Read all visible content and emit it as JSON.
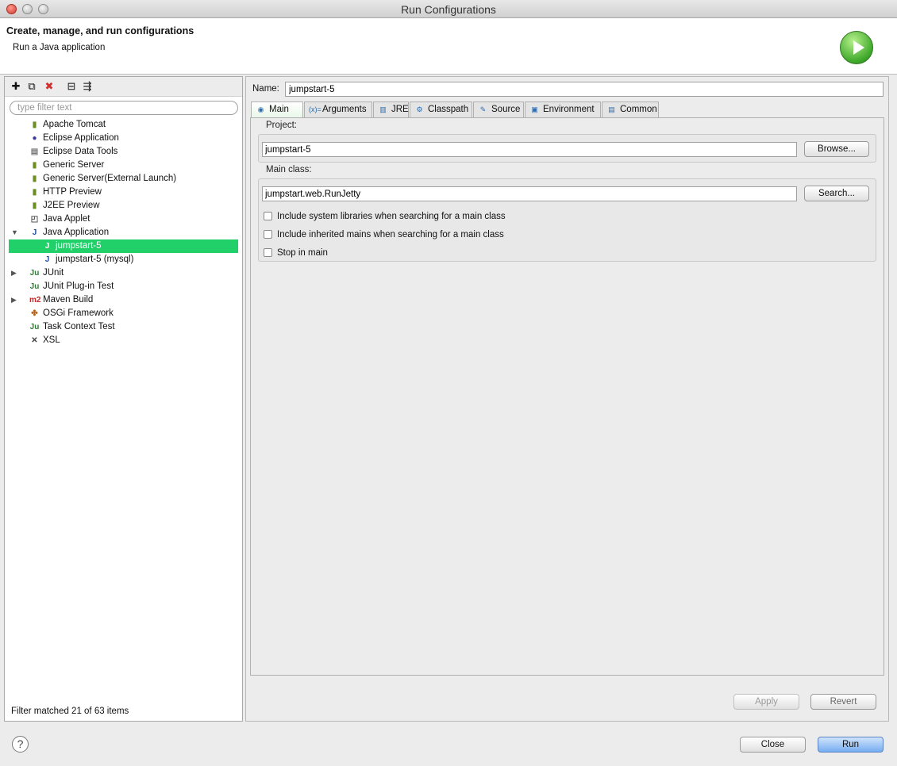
{
  "window": {
    "title": "Run Configurations"
  },
  "header": {
    "title": "Create, manage, and run configurations",
    "subtitle": "Run a Java application"
  },
  "left": {
    "toolbar": [
      {
        "name": "new-config-icon",
        "glyph": "✚"
      },
      {
        "name": "duplicate-icon",
        "glyph": "⧉"
      },
      {
        "name": "delete-icon",
        "glyph": "✖"
      },
      {
        "name": "collapse-all-icon",
        "glyph": "⊟"
      },
      {
        "name": "filter-menu-icon",
        "glyph": "⇶"
      }
    ],
    "filter_placeholder": "type filter text",
    "status": "Filter matched 21 of 63 items"
  },
  "tree": [
    {
      "label": "Apache Tomcat",
      "icon": "tomcat-icon",
      "glyph": "▮",
      "color": "#6b8e23",
      "level": 0
    },
    {
      "label": "Eclipse Application",
      "icon": "eclipse-icon",
      "glyph": "●",
      "color": "#3b3b9e",
      "level": 0
    },
    {
      "label": "Eclipse Data Tools",
      "icon": "database-icon",
      "glyph": "▤",
      "color": "#777777",
      "level": 0
    },
    {
      "label": "Generic Server",
      "icon": "server-icon",
      "glyph": "▮",
      "color": "#6b8e23",
      "level": 0
    },
    {
      "label": "Generic Server(External Launch)",
      "icon": "server-icon",
      "glyph": "▮",
      "color": "#6b8e23",
      "level": 0
    },
    {
      "label": "HTTP Preview",
      "icon": "server-icon",
      "glyph": "▮",
      "color": "#6b8e23",
      "level": 0
    },
    {
      "label": "J2EE Preview",
      "icon": "server-icon",
      "glyph": "▮",
      "color": "#6b8e23",
      "level": 0
    },
    {
      "label": "Java Applet",
      "icon": "applet-icon",
      "glyph": "◰",
      "color": "#555555",
      "level": 0
    },
    {
      "label": "Java Application",
      "icon": "java-app-icon",
      "glyph": "J",
      "color": "#1e4fa0",
      "level": 0,
      "expanded": true
    },
    {
      "label": "jumpstart-5",
      "icon": "java-config-icon",
      "glyph": "J",
      "color": "#1e4fa0",
      "level": 1,
      "selected": true
    },
    {
      "label": "jumpstart-5 (mysql)",
      "icon": "java-config-icon",
      "glyph": "J",
      "color": "#1e4fa0",
      "level": 1
    },
    {
      "label": "JUnit",
      "icon": "junit-icon",
      "glyph": "Ju",
      "color": "#2e7d32",
      "level": 0,
      "collapsed": true
    },
    {
      "label": "JUnit Plug-in Test",
      "icon": "junit-plugin-icon",
      "glyph": "Ju",
      "color": "#2e7d32",
      "level": 0
    },
    {
      "label": "Maven Build",
      "icon": "maven-icon",
      "glyph": "m2",
      "color": "#c62828",
      "level": 0,
      "collapsed": true
    },
    {
      "label": "OSGi Framework",
      "icon": "osgi-icon",
      "glyph": "✤",
      "color": "#b5651d",
      "level": 0
    },
    {
      "label": "Task Context Test",
      "icon": "task-context-icon",
      "glyph": "Ju",
      "color": "#2e7d32",
      "level": 0
    },
    {
      "label": "XSL",
      "icon": "xsl-icon",
      "glyph": "✕",
      "color": "#444444",
      "level": 0
    }
  ],
  "form": {
    "name_label": "Name:",
    "name_value": "jumpstart-5",
    "tabs": [
      {
        "label": "Main",
        "icon": "main-tab-icon",
        "glyph": "◉",
        "active": true
      },
      {
        "label": "Arguments",
        "icon": "arguments-icon",
        "glyph": "(x)=",
        "active": false
      },
      {
        "label": "JRE",
        "icon": "jre-icon",
        "glyph": "▥",
        "active": false
      },
      {
        "label": "Classpath",
        "icon": "classpath-icon",
        "glyph": "⚙",
        "active": false
      },
      {
        "label": "Source",
        "icon": "source-icon",
        "glyph": "✎",
        "active": false
      },
      {
        "label": "Environment",
        "icon": "environment-icon",
        "glyph": "▣",
        "active": false
      },
      {
        "label": "Common",
        "icon": "common-icon",
        "glyph": "▤",
        "active": false
      }
    ],
    "project_label": "Project:",
    "project_value": "jumpstart-5",
    "browse_label": "Browse...",
    "main_class_label": "Main class:",
    "main_class_value": "jumpstart.web.RunJetty",
    "search_label": "Search...",
    "checkboxes": [
      {
        "label": "Include system libraries when searching for a main class",
        "checked": false
      },
      {
        "label": "Include inherited mains when searching for a main class",
        "checked": false
      },
      {
        "label": "Stop in main",
        "checked": false
      }
    ],
    "apply_label": "Apply",
    "revert_label": "Revert"
  },
  "footer": {
    "help_glyph": "?",
    "close_label": "Close",
    "run_label": "Run"
  }
}
